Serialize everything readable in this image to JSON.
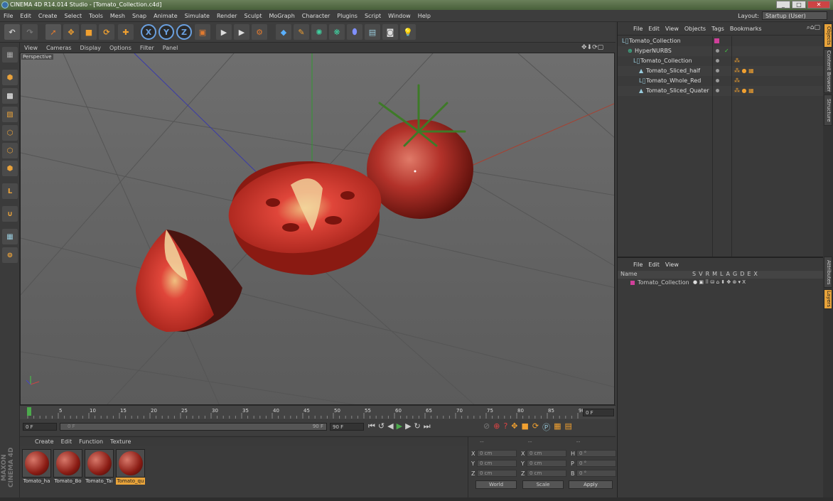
{
  "window": {
    "title": "CINEMA 4D R14.014 Studio - [Tomato_Collection.c4d]",
    "min": "_",
    "max": "□",
    "close": "✕"
  },
  "menu": [
    "File",
    "Edit",
    "Create",
    "Select",
    "Tools",
    "Mesh",
    "Snap",
    "Animate",
    "Simulate",
    "Render",
    "Sculpt",
    "MoGraph",
    "Character",
    "Plugins",
    "Script",
    "Window",
    "Help"
  ],
  "layout": {
    "label": "Layout:",
    "value": "Startup (User)"
  },
  "toolbar": {
    "x_label": "X",
    "y_label": "Y",
    "z_label": "Z"
  },
  "viewport": {
    "menu": [
      "View",
      "Cameras",
      "Display",
      "Options",
      "Filter",
      "Panel"
    ],
    "label": "Perspective"
  },
  "timeline": {
    "ticks": [
      "0",
      "5",
      "10",
      "15",
      "20",
      "25",
      "30",
      "35",
      "40",
      "45",
      "50",
      "55",
      "60",
      "65",
      "70",
      "75",
      "80",
      "85",
      "90"
    ],
    "current": "0 F",
    "start": "0 F",
    "range_start": "0 F",
    "range_end": "90 F",
    "end": "90 F"
  },
  "materials": {
    "menu": [
      "Create",
      "Edit",
      "Function",
      "Texture"
    ],
    "items": [
      {
        "name": "Tomato_ha"
      },
      {
        "name": "Tomato_Bo"
      },
      {
        "name": "Tomato_Tai"
      },
      {
        "name": "Tomato_qu"
      }
    ],
    "selected_index": 3,
    "brand": "MAXON CINEMA 4D"
  },
  "coords": {
    "headers": [
      "--",
      "--",
      "--"
    ],
    "rows": [
      {
        "a": "X",
        "av": "0 cm",
        "b": "X",
        "bv": "0 cm",
        "c": "H",
        "cv": "0 °"
      },
      {
        "a": "Y",
        "av": "0 cm",
        "b": "Y",
        "bv": "0 cm",
        "c": "P",
        "cv": "0 °"
      },
      {
        "a": "Z",
        "av": "0 cm",
        "b": "Z",
        "bv": "0 cm",
        "c": "B",
        "cv": "0 °"
      }
    ],
    "world": "World",
    "scale": "Scale",
    "apply": "Apply"
  },
  "object_manager": {
    "menu": [
      "File",
      "Edit",
      "View",
      "Objects",
      "Tags",
      "Bookmarks"
    ],
    "objects": [
      {
        "name": "Tomato_Collection",
        "indent": 0
      },
      {
        "name": "HyperNURBS",
        "indent": 1
      },
      {
        "name": "Tomato_Collection",
        "indent": 2
      },
      {
        "name": "Tomato_Sliced_half",
        "indent": 3
      },
      {
        "name": "Tomato_Whole_Red",
        "indent": 3
      },
      {
        "name": "Tomato_Sliced_Quater",
        "indent": 3
      }
    ]
  },
  "layer_manager": {
    "menu": [
      "File",
      "Edit",
      "View"
    ],
    "header": "Name",
    "cols": [
      "S",
      "V",
      "R",
      "M",
      "L",
      "A",
      "G",
      "D",
      "E",
      "X"
    ],
    "layer_name": "Tomato_Collection"
  },
  "side_tabs": [
    "Objects",
    "Content Browser",
    "Structure",
    "Attributes",
    "Layers"
  ],
  "colors": {
    "accent": "#e8a33a",
    "tomato": "#b8322a",
    "layer": "#d0409a"
  }
}
